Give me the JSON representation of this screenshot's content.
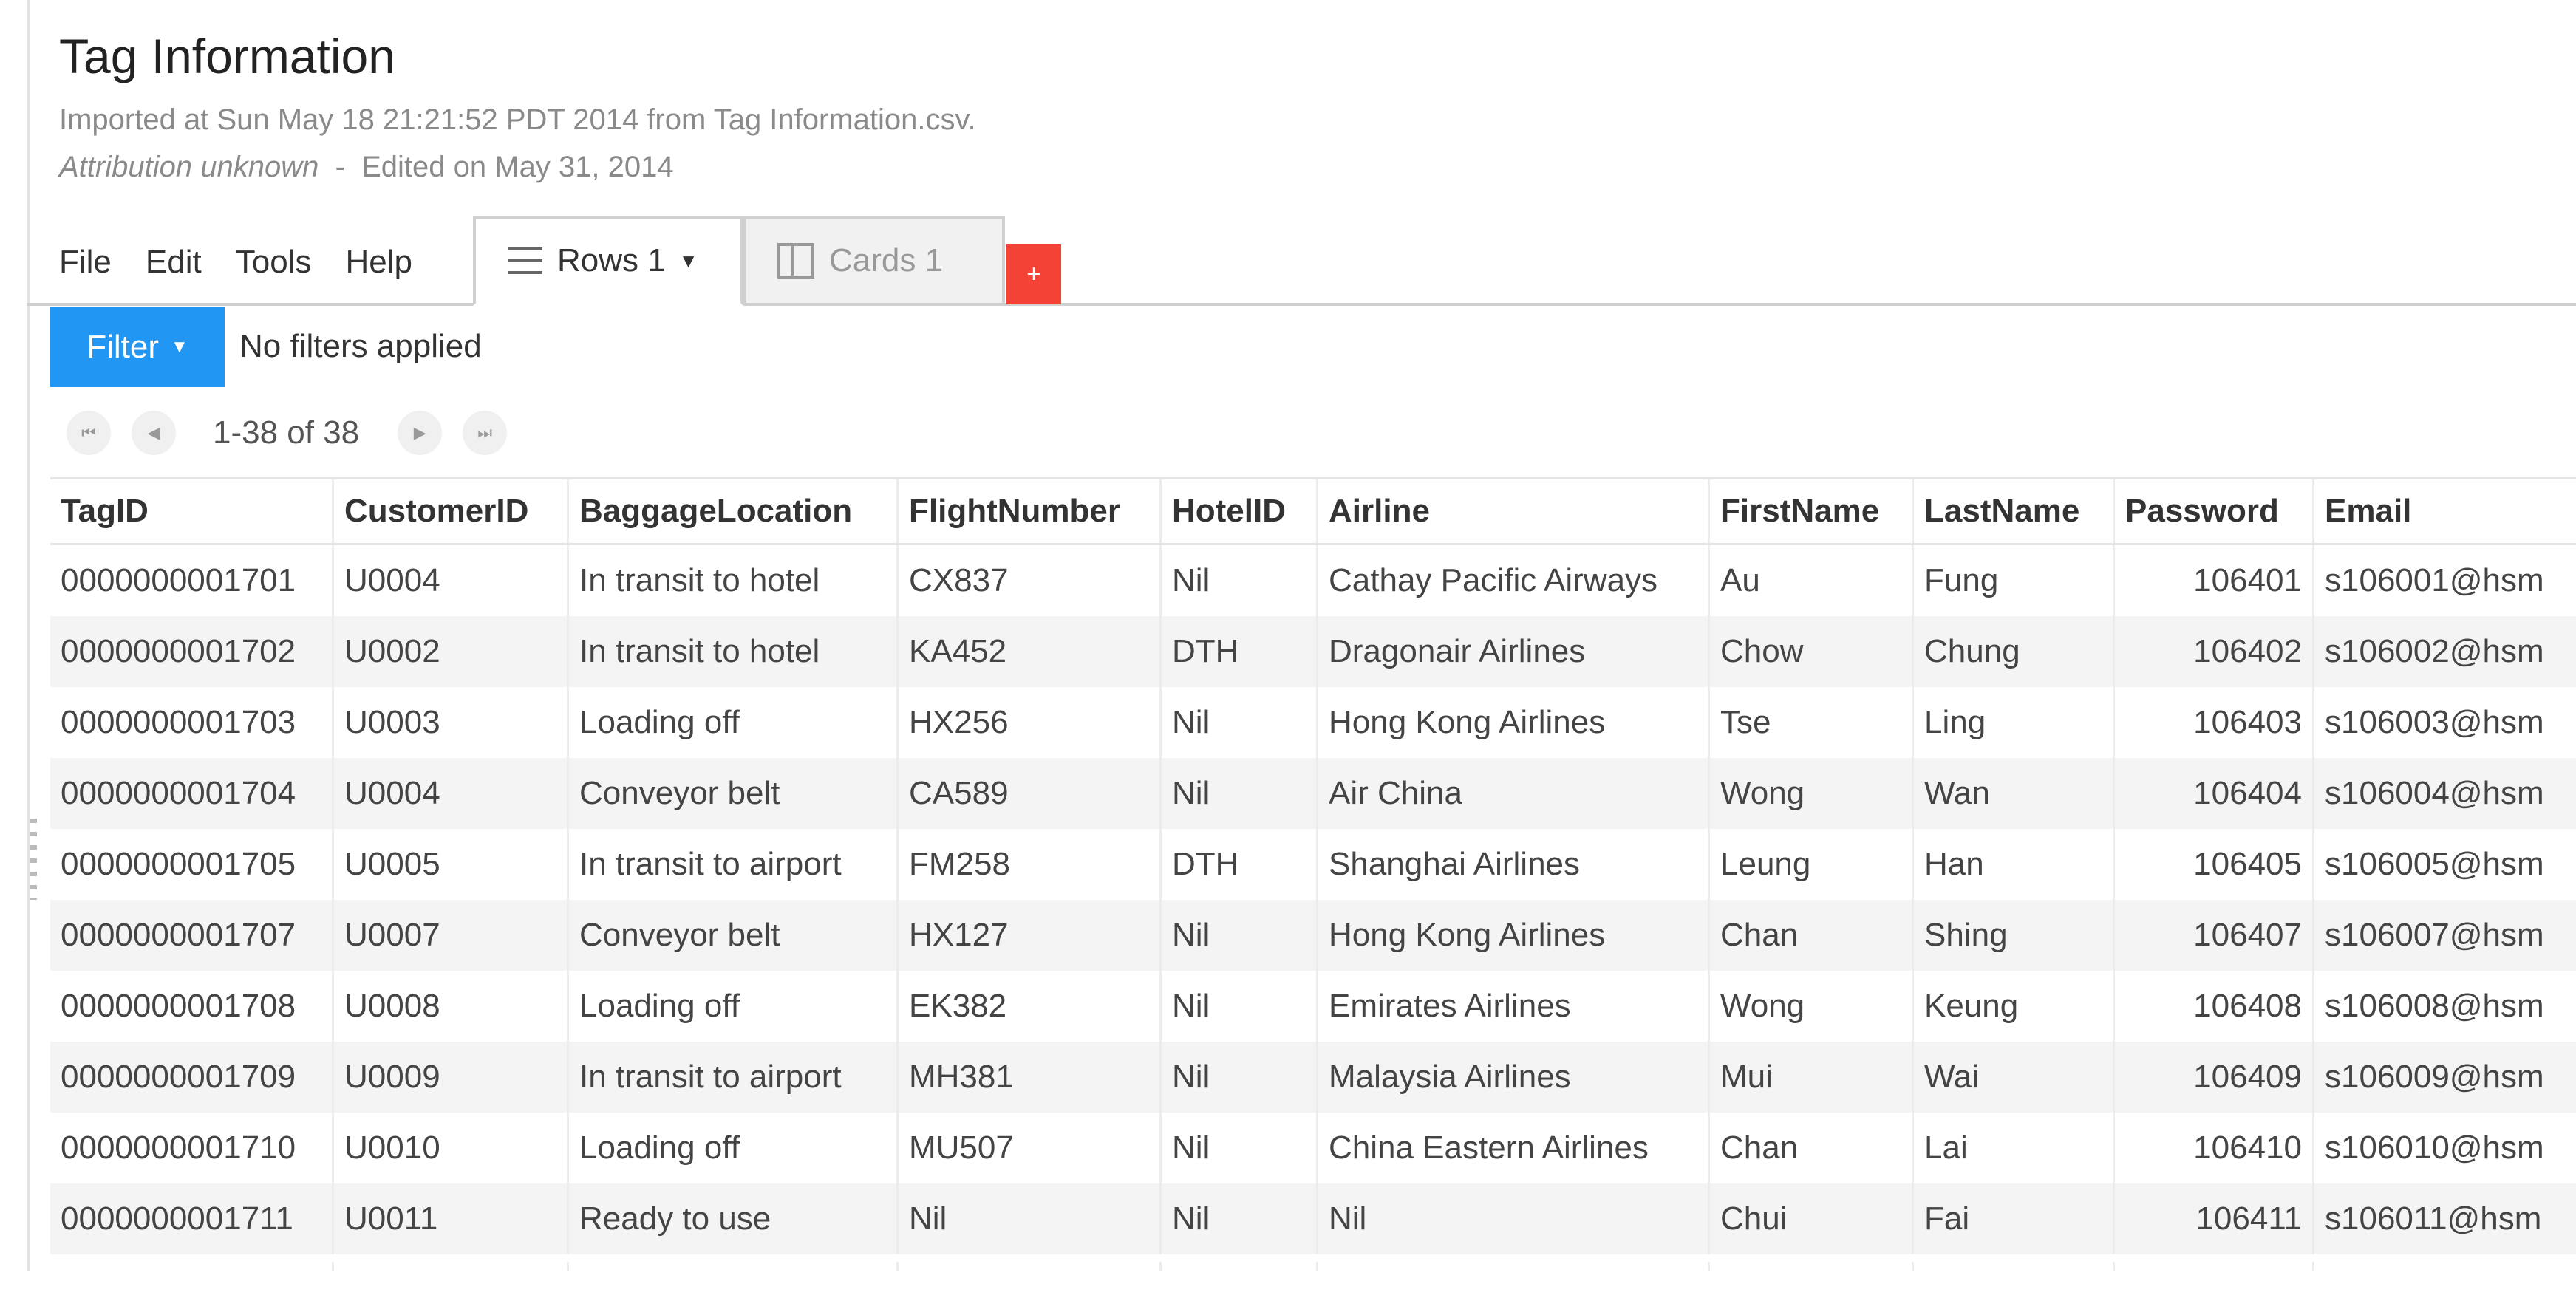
{
  "header": {
    "title": "Tag Information",
    "imported": "Imported at Sun May 18 21:21:52 PDT 2014 from Tag Information.csv.",
    "attribution": "Attribution unknown",
    "separator": "-",
    "edited": "Edited on May 31, 2014"
  },
  "menu": [
    "File",
    "Edit",
    "Tools",
    "Help"
  ],
  "tabs": {
    "rows_label": "Rows 1",
    "cards_label": "Cards 1",
    "add_label": "+"
  },
  "filter": {
    "button_label": "Filter",
    "status": "No filters applied"
  },
  "pager": {
    "range": "1-38 of 38",
    "first_icon": "skip-first-icon",
    "prev_icon": "prev-icon",
    "next_icon": "next-icon",
    "last_icon": "skip-last-icon"
  },
  "table": {
    "columns": [
      "TagID",
      "CustomerID",
      "BaggageLocation",
      "FlightNumber",
      "HotelID",
      "Airline",
      "FirstName",
      "LastName",
      "Password",
      "Email"
    ],
    "rows": [
      [
        "0000000001701",
        "U0004",
        "In transit to hotel",
        "CX837",
        "Nil",
        "Cathay Pacific Airways",
        "Au",
        "Fung",
        "106401",
        "s106001@hsm"
      ],
      [
        "0000000001702",
        "U0002",
        "In transit to hotel",
        "KA452",
        "DTH",
        "Dragonair Airlines",
        "Chow",
        "Chung",
        "106402",
        "s106002@hsm"
      ],
      [
        "0000000001703",
        "U0003",
        "Loading off",
        "HX256",
        "Nil",
        "Hong Kong Airlines",
        "Tse",
        "Ling",
        "106403",
        "s106003@hsm"
      ],
      [
        "0000000001704",
        "U0004",
        "Conveyor belt",
        "CA589",
        "Nil",
        "Air China",
        "Wong",
        "Wan",
        "106404",
        "s106004@hsm"
      ],
      [
        "0000000001705",
        "U0005",
        "In transit to airport",
        "FM258",
        "DTH",
        "Shanghai Airlines",
        "Leung",
        "Han",
        "106405",
        "s106005@hsm"
      ],
      [
        "0000000001707",
        "U0007",
        "Conveyor belt",
        "HX127",
        "Nil",
        "Hong Kong Airlines",
        "Chan",
        "Shing",
        "106407",
        "s106007@hsm"
      ],
      [
        "0000000001708",
        "U0008",
        "Loading off",
        "EK382",
        "Nil",
        "Emirates Airlines",
        "Wong",
        "Keung",
        "106408",
        "s106008@hsm"
      ],
      [
        "0000000001709",
        "U0009",
        "In transit to airport",
        "MH381",
        "Nil",
        "Malaysia Airlines",
        "Mui",
        "Wai",
        "106409",
        "s106009@hsm"
      ],
      [
        "0000000001710",
        "U0010",
        "Loading off",
        "MU507",
        "Nil",
        "China Eastern Airlines",
        "Chan",
        "Lai",
        "106410",
        "s106010@hsm"
      ],
      [
        "0000000001711",
        "U0011",
        "Ready to use",
        "Nil",
        "Nil",
        "Nil",
        "Chui",
        "Fai",
        "106411",
        "s106011@hsm"
      ]
    ]
  },
  "colors": {
    "filter_blue": "#2196f3",
    "add_tab_red": "#f44336"
  }
}
